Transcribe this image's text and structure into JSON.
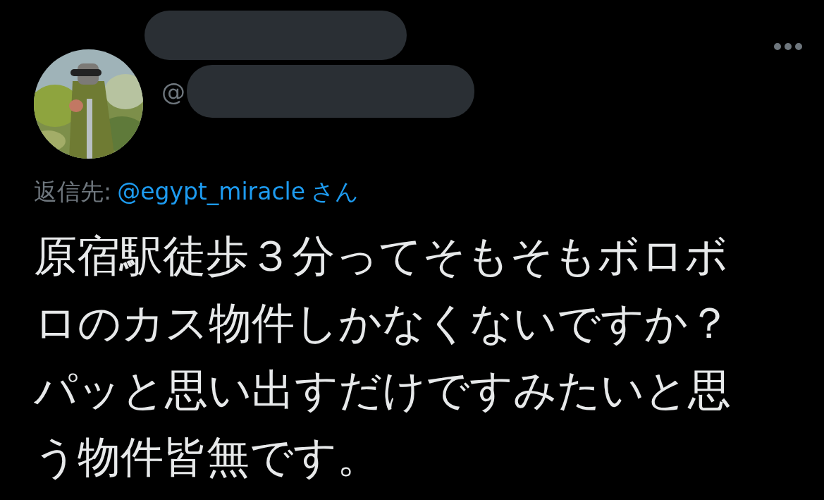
{
  "author": {
    "handle_prefix": "@"
  },
  "reply_to": {
    "label": "返信先:",
    "handle": "@egypt_miracle",
    "suffix": "さん"
  },
  "text": "原宿駅徒歩３分ってそもそもボロボロのカス物件しかなくないですか？パッと思い出すだけですみたいと思う物件皆無です。"
}
